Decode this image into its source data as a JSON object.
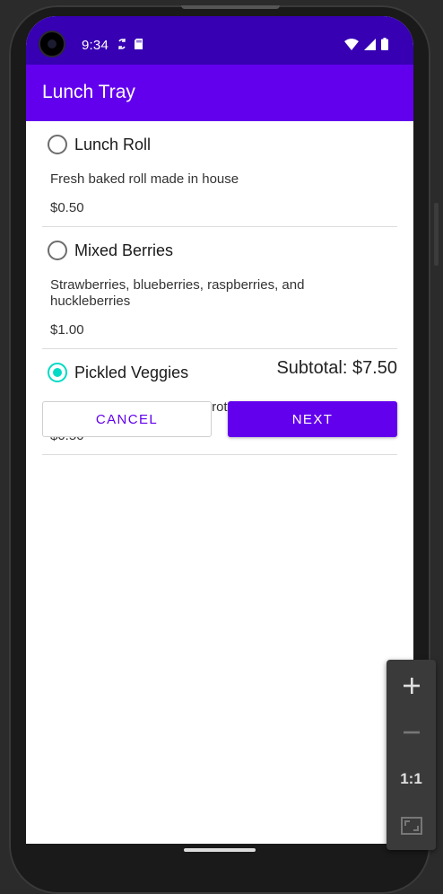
{
  "status_bar": {
    "time": "9:34",
    "left_icons": [
      "sync-icon",
      "sd-card-icon"
    ],
    "right_icons": [
      "wifi-icon",
      "cellular-signal-icon",
      "battery-icon"
    ]
  },
  "app_bar": {
    "title": "Lunch Tray"
  },
  "items": [
    {
      "name": "Lunch Roll",
      "description": "Fresh baked roll made in house",
      "price": "$0.50",
      "selected": false
    },
    {
      "name": "Mixed Berries",
      "description": "Strawberries, blueberries, raspberries, and huckleberries",
      "price": "$1.00",
      "selected": false
    },
    {
      "name": "Pickled Veggies",
      "description": "Pickled cucumbers and carrots, made in house",
      "price": "$0.50",
      "selected": true
    }
  ],
  "subtotal": "Subtotal: $7.50",
  "buttons": {
    "cancel": "CANCEL",
    "next": "NEXT"
  },
  "colors": {
    "status_bar": "#3700b3",
    "app_bar": "#6200ee",
    "primary": "#6200ee",
    "radio_checked": "#03dac5"
  },
  "emulator_zoom_controls": {
    "fit_label": "1:1"
  }
}
